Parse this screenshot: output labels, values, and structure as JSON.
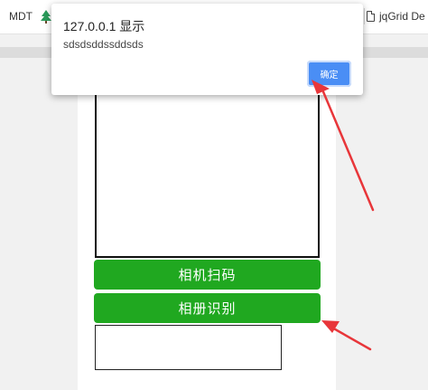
{
  "bookmarks_bar": {
    "items": [
      {
        "label": "MDT"
      },
      {
        "label": ""
      },
      {
        "label": "jqGrid De"
      }
    ]
  },
  "alert_dialog": {
    "title": "127.0.0.1 显示",
    "message": "sdsdsddssddsds",
    "ok_label": "确定",
    "ok_color": "#4a8ef5"
  },
  "page": {
    "camera_button_label": "相机扫码",
    "album_button_label": "相册识别",
    "button_color": "#20a820",
    "result_value": ""
  },
  "annotations": {
    "arrow_color": "#e8363a"
  }
}
